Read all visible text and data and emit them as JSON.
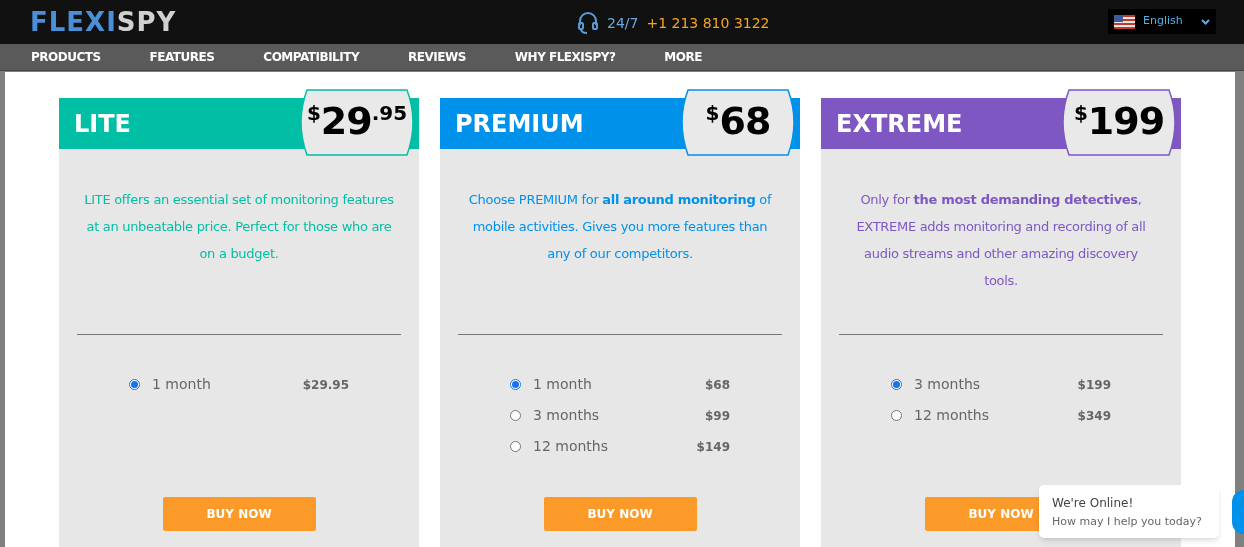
{
  "header": {
    "logo_primary": "FLEXI",
    "logo_secondary": "SPY",
    "support_hours": "24/7",
    "phone": "+1 213 810 3122",
    "language": "English"
  },
  "nav": [
    "PRODUCTS",
    "FEATURES",
    "COMPATIBILITY",
    "REVIEWS",
    "WHY FLEXISPY?",
    "MORE"
  ],
  "plans": [
    {
      "name": "LITE",
      "color": "#00bfa5",
      "currency": "$",
      "amount": "29",
      "cents": ".95",
      "description": "LITE offers an essential set of monitoring features at an unbeatable price. Perfect for those who are on a budget.",
      "options": [
        {
          "label": "1 month",
          "price": "$29.95",
          "selected": true
        }
      ],
      "button": "BUY NOW"
    },
    {
      "name": "PREMIUM",
      "color": "#0091ea",
      "currency": "$",
      "amount": "68",
      "description": "Choose PREMIUM for **all around monitoring** of mobile activities. Gives you more features than any of our competitors.",
      "options": [
        {
          "label": "1 month",
          "price": "$68",
          "selected": true
        },
        {
          "label": "3 months",
          "price": "$99",
          "selected": false
        },
        {
          "label": "12 months",
          "price": "$149",
          "selected": false
        }
      ],
      "button": "BUY NOW"
    },
    {
      "name": "EXTREME",
      "color": "#7e57c2",
      "currency": "$",
      "amount": "199",
      "description": "Only for **the most demanding detectives**, EXTREME adds monitoring and recording of all audio streams and other amazing discovery tools.",
      "options": [
        {
          "label": "3 months",
          "price": "$199",
          "selected": true
        },
        {
          "label": "12 months",
          "price": "$349",
          "selected": false
        }
      ],
      "button": "BUY NOW"
    }
  ],
  "chat": {
    "title": "We're Online!",
    "message": "How may I help you today?"
  }
}
